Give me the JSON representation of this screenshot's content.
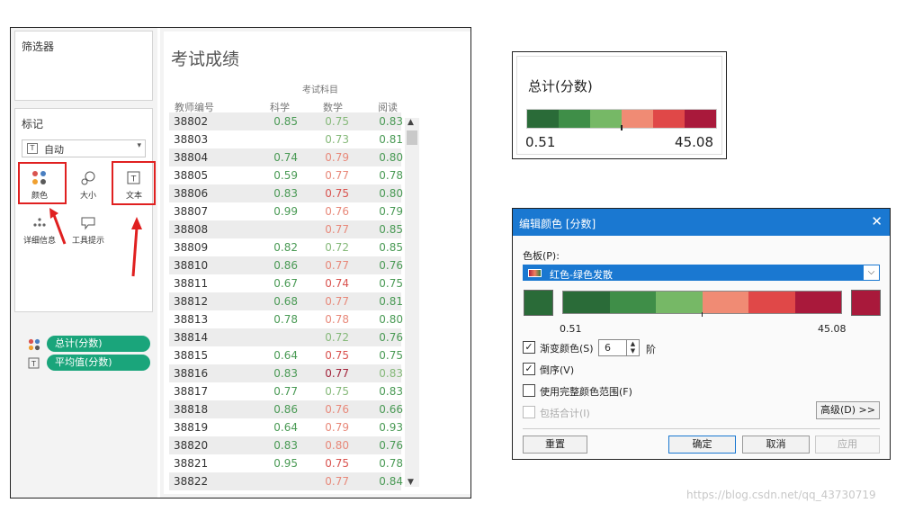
{
  "marks_panel": {
    "filters_title": "筛选器",
    "marks_title": "标记",
    "mark_type": "自动",
    "buttons": {
      "color": "颜色",
      "size": "大小",
      "label": "文本",
      "detail": "详细信息",
      "tooltip": "工具提示"
    },
    "pills": [
      {
        "label": "总计(分数)",
        "icon": "color-dots-icon"
      },
      {
        "label": "平均值(分数)",
        "icon": "text-t-icon"
      }
    ]
  },
  "sheet": {
    "title": "考试成绩",
    "subject_header": "考试科目",
    "columns": [
      "教师编号",
      "科学",
      "数学",
      "阅读"
    ],
    "rows": [
      [
        "38802",
        "0.85",
        "0.75",
        "0.83"
      ],
      [
        "38803",
        "",
        "0.73",
        "0.81"
      ],
      [
        "38804",
        "0.74",
        "0.79",
        "0.80"
      ],
      [
        "38805",
        "0.59",
        "0.77",
        "0.78"
      ],
      [
        "38806",
        "0.83",
        "0.75",
        "0.80"
      ],
      [
        "38807",
        "0.99",
        "0.76",
        "0.79"
      ],
      [
        "38808",
        "",
        "0.77",
        "0.85"
      ],
      [
        "38809",
        "0.82",
        "0.72",
        "0.85"
      ],
      [
        "38810",
        "0.86",
        "0.77",
        "0.76"
      ],
      [
        "38811",
        "0.67",
        "0.74",
        "0.75"
      ],
      [
        "38812",
        "0.68",
        "0.77",
        "0.81"
      ],
      [
        "38813",
        "0.78",
        "0.78",
        "0.80"
      ],
      [
        "38814",
        "",
        "0.72",
        "0.76"
      ],
      [
        "38815",
        "0.64",
        "0.75",
        "0.75"
      ],
      [
        "38816",
        "0.83",
        "0.77",
        "0.83"
      ],
      [
        "38817",
        "0.77",
        "0.75",
        "0.83"
      ],
      [
        "38818",
        "0.86",
        "0.76",
        "0.66"
      ],
      [
        "38819",
        "0.64",
        "0.79",
        "0.93"
      ],
      [
        "38820",
        "0.83",
        "0.80",
        "0.76"
      ],
      [
        "38821",
        "0.95",
        "0.75",
        "0.78"
      ],
      [
        "38822",
        "",
        "0.77",
        "0.84"
      ]
    ],
    "cell_colors": [
      [
        "#4a9a55",
        "#86b97a",
        "#4a9a55"
      ],
      [
        "",
        "#86b97a",
        "#4a9a55"
      ],
      [
        "#4a9a55",
        "#e8897a",
        "#4a9a55"
      ],
      [
        "#4a9a55",
        "#e8897a",
        "#4a9a55"
      ],
      [
        "#4a9a55",
        "#d9534f",
        "#4a9a55"
      ],
      [
        "#4a9a55",
        "#e8897a",
        "#4a9a55"
      ],
      [
        "",
        "#e8897a",
        "#4a9a55"
      ],
      [
        "#4a9a55",
        "#86b97a",
        "#4a9a55"
      ],
      [
        "#4a9a55",
        "#e8897a",
        "#4a9a55"
      ],
      [
        "#4a9a55",
        "#d9534f",
        "#4a9a55"
      ],
      [
        "#4a9a55",
        "#e8897a",
        "#4a9a55"
      ],
      [
        "#4a9a55",
        "#e8897a",
        "#4a9a55"
      ],
      [
        "",
        "#86b97a",
        "#4a9a55"
      ],
      [
        "#4a9a55",
        "#d9534f",
        "#4a9a55"
      ],
      [
        "#4a9a55",
        "#a3243b",
        "#86b97a"
      ],
      [
        "#4a9a55",
        "#86b97a",
        "#4a9a55"
      ],
      [
        "#4a9a55",
        "#e8897a",
        "#4a9a55"
      ],
      [
        "#4a9a55",
        "#e8897a",
        "#4a9a55"
      ],
      [
        "#4a9a55",
        "#e8897a",
        "#4a9a55"
      ],
      [
        "#4a9a55",
        "#d9534f",
        "#4a9a55"
      ],
      [
        "",
        "#e8897a",
        "#4a9a55"
      ]
    ]
  },
  "legend": {
    "title": "总计(分数)",
    "min": "0.51",
    "max": "45.08",
    "steps": [
      "#2a6b38",
      "#3f8e48",
      "#76b866",
      "#f08b74",
      "#e04848",
      "#a9193b"
    ]
  },
  "dialog": {
    "title": "编辑颜色 [分数]",
    "palette_label": "色板(P):",
    "palette_value": "红色-绿色发散",
    "min": "0.51",
    "max": "45.08",
    "steps": [
      "#2a6b38",
      "#3f8e48",
      "#76b866",
      "#f08b74",
      "#e04848",
      "#a9193b"
    ],
    "stepped_label": "渐变颜色(S)",
    "stepped_checked": true,
    "steps_value": "6",
    "steps_unit": "阶",
    "reversed_label": "倒序(V)",
    "reversed_checked": true,
    "fullrange_label": "使用完整颜色范围(F)",
    "fullrange_checked": false,
    "totals_label": "包括合计(I)",
    "totals_checked": false,
    "advanced": "高级(D) >>",
    "reset": "重置",
    "ok": "确定",
    "cancel": "取消",
    "apply": "应用"
  },
  "watermark": "https://blog.csdn.net/qq_43730719"
}
